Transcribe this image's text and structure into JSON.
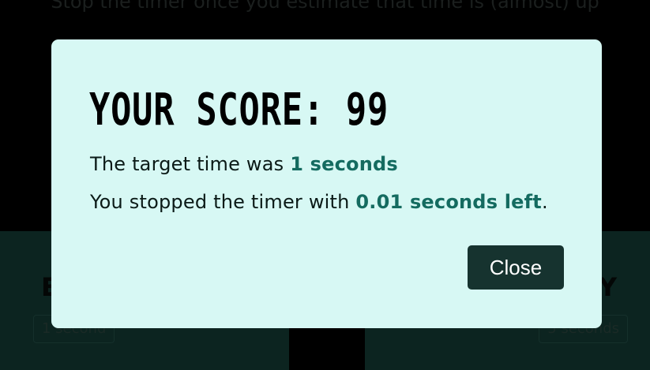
{
  "background": {
    "instructions": "Stop the timer once you estimate that time is (almost) up",
    "cards": [
      {
        "title": "E",
        "chip": "1 second"
      },
      {
        "title": "Y",
        "chip": "5 seconds"
      }
    ]
  },
  "modal": {
    "title": "YOUR SCORE: 99",
    "line1": {
      "prefix": "The target time was ",
      "value": "1 seconds"
    },
    "line2": {
      "prefix": "You stopped the timer with ",
      "value": "0.01 seconds left",
      "suffix": "."
    },
    "close_label": "Close"
  },
  "colors": {
    "modal_background": "#d7f8f4",
    "accent": "#146b60",
    "button": "#16332f"
  }
}
